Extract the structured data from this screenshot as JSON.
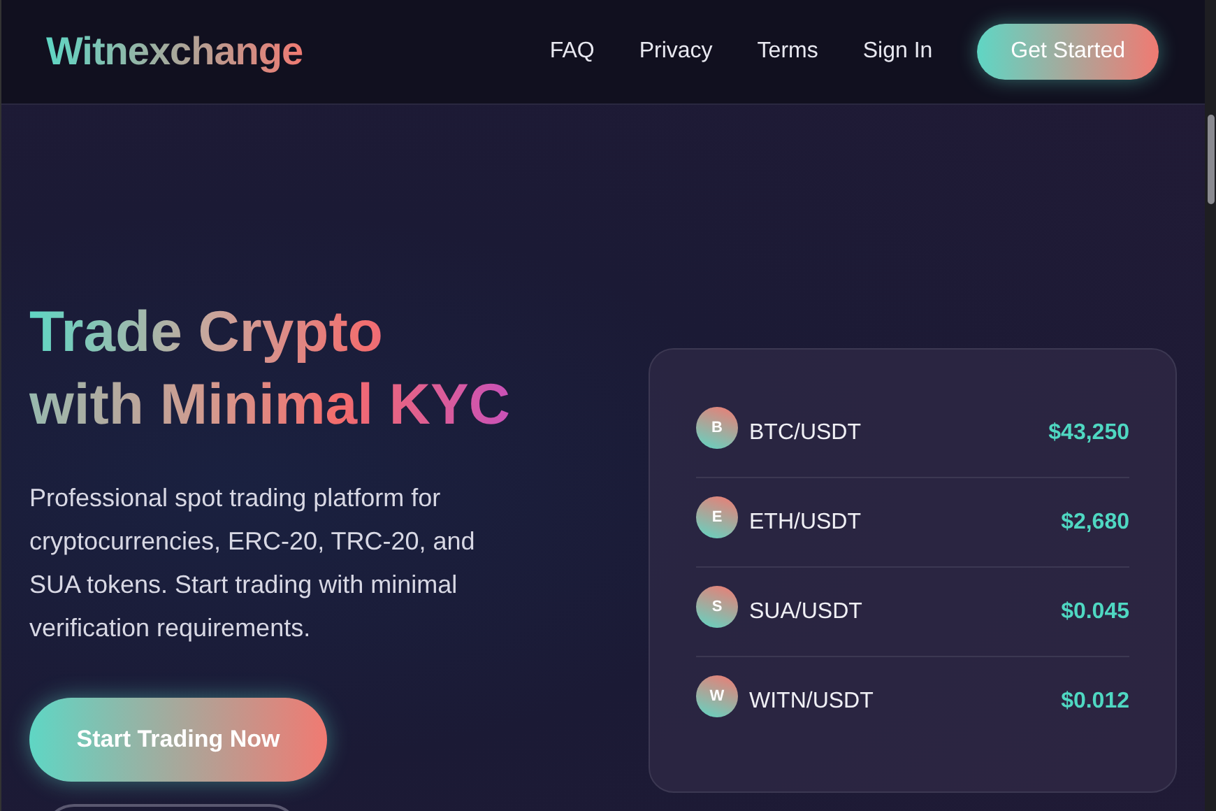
{
  "header": {
    "logo": "Witnexchange",
    "nav": [
      "FAQ",
      "Privacy",
      "Terms",
      "Sign In"
    ],
    "cta": "Get Started"
  },
  "hero": {
    "headline_lines": [
      "Trade Crypto",
      "with Minimal KYC"
    ],
    "description": "Professional spot trading platform for cryptocurrencies, ERC-20, TRC-20, and SUA tokens. Start trading with minimal verification requirements.",
    "primary_button": "Start Trading Now"
  },
  "pairs": [
    {
      "letter": "B",
      "pair": "BTC/USDT",
      "price": "$43,250"
    },
    {
      "letter": "E",
      "pair": "ETH/USDT",
      "price": "$2,680"
    },
    {
      "letter": "S",
      "pair": "SUA/USDT",
      "price": "$0.045"
    },
    {
      "letter": "W",
      "pair": "WITN/USDT",
      "price": "$0.012"
    }
  ]
}
